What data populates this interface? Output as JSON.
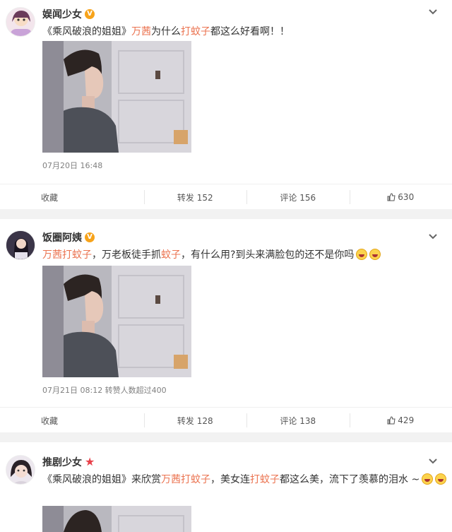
{
  "posts": [
    {
      "username": "娱闻少女",
      "badge": "V",
      "segments": [
        {
          "t": "《乘风破浪的姐姐》",
          "hl": false
        },
        {
          "t": "万茜",
          "hl": true
        },
        {
          "t": "为什么",
          "hl": false
        },
        {
          "t": "打蚊子",
          "hl": true
        },
        {
          "t": "都这么好看啊！！",
          "hl": false
        }
      ],
      "meta": "07月20日 16:48",
      "collect_label": "收藏",
      "repost_label": "转发 152",
      "comment_label": "评论 156",
      "like_count": "630"
    },
    {
      "username": "饭圈阿姨",
      "badge": "V",
      "segments": [
        {
          "t": "万茜打蚊子",
          "hl": true
        },
        {
          "t": "，万老板徒手抓",
          "hl": false
        },
        {
          "t": "蚊子",
          "hl": true
        },
        {
          "t": "，有什么用?到头来满脸包的还不是你吗",
          "hl": false
        }
      ],
      "meta": "07月21日 08:12 转赞人数超过400",
      "collect_label": "收藏",
      "repost_label": "转发 128",
      "comment_label": "评论 138",
      "like_count": "429"
    },
    {
      "username": "推剧少女",
      "badge": "★",
      "segments": [
        {
          "t": "《乘风破浪的姐姐》来欣赏",
          "hl": false
        },
        {
          "t": "万茜打蚊子",
          "hl": true
        },
        {
          "t": "，美女连",
          "hl": false
        },
        {
          "t": "打蚊子",
          "hl": true
        },
        {
          "t": "都这么美，流下了羡慕的泪水 ~",
          "hl": false
        }
      ]
    }
  ],
  "colors": {
    "highlight": "#eb7350",
    "vip_badge": "#f7a31a",
    "star_badge": "#e8414a"
  },
  "icons": [
    "chevron-down-icon",
    "thumb-up-icon",
    "grin-emoji-icon",
    "cry-emoji-icon"
  ]
}
